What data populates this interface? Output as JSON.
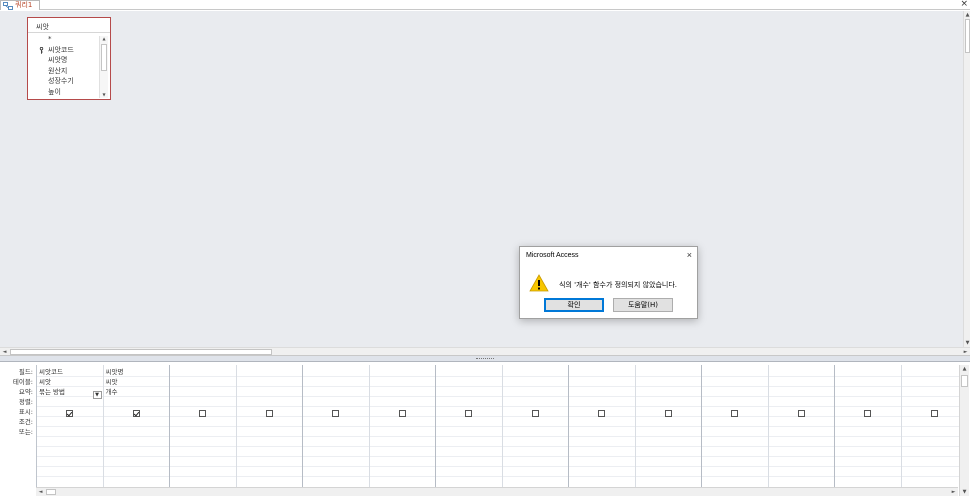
{
  "tab": {
    "label": "쿼리1",
    "close": "×"
  },
  "table_box": {
    "title": "씨앗",
    "fields": [
      "*",
      "씨앗코드",
      "씨앗명",
      "원산지",
      "성장수기",
      "높이"
    ]
  },
  "dialog": {
    "title": "Microsoft Access",
    "message": "식의 '개수' 함수가 정의되지 않았습니다.",
    "ok_label": "확인",
    "help_label": "도움말(H)",
    "close": "×"
  },
  "grid": {
    "row_labels": [
      "필드:",
      "테이블:",
      "요약:",
      "정렬:",
      "표시:",
      "조건:",
      "또는:"
    ],
    "columns": [
      {
        "field": "씨앗코드",
        "table": "씨앗",
        "total": "묶는 방법",
        "show": true
      },
      {
        "field": "씨앗명",
        "table": "씨앗",
        "total": "개수",
        "show": true
      },
      {
        "field": "",
        "table": "",
        "total": "",
        "show": false
      },
      {
        "field": "",
        "table": "",
        "total": "",
        "show": false
      },
      {
        "field": "",
        "table": "",
        "total": "",
        "show": false
      },
      {
        "field": "",
        "table": "",
        "total": "",
        "show": false
      },
      {
        "field": "",
        "table": "",
        "total": "",
        "show": false
      },
      {
        "field": "",
        "table": "",
        "total": "",
        "show": false
      },
      {
        "field": "",
        "table": "",
        "total": "",
        "show": false
      },
      {
        "field": "",
        "table": "",
        "total": "",
        "show": false
      },
      {
        "field": "",
        "table": "",
        "total": "",
        "show": false
      },
      {
        "field": "",
        "table": "",
        "total": "",
        "show": false
      },
      {
        "field": "",
        "table": "",
        "total": "",
        "show": false
      },
      {
        "field": "",
        "table": "",
        "total": "",
        "show": false
      }
    ]
  },
  "colors": {
    "accent": "#b7472a",
    "surface": "#e9ebef",
    "focus": "#0078d7"
  }
}
